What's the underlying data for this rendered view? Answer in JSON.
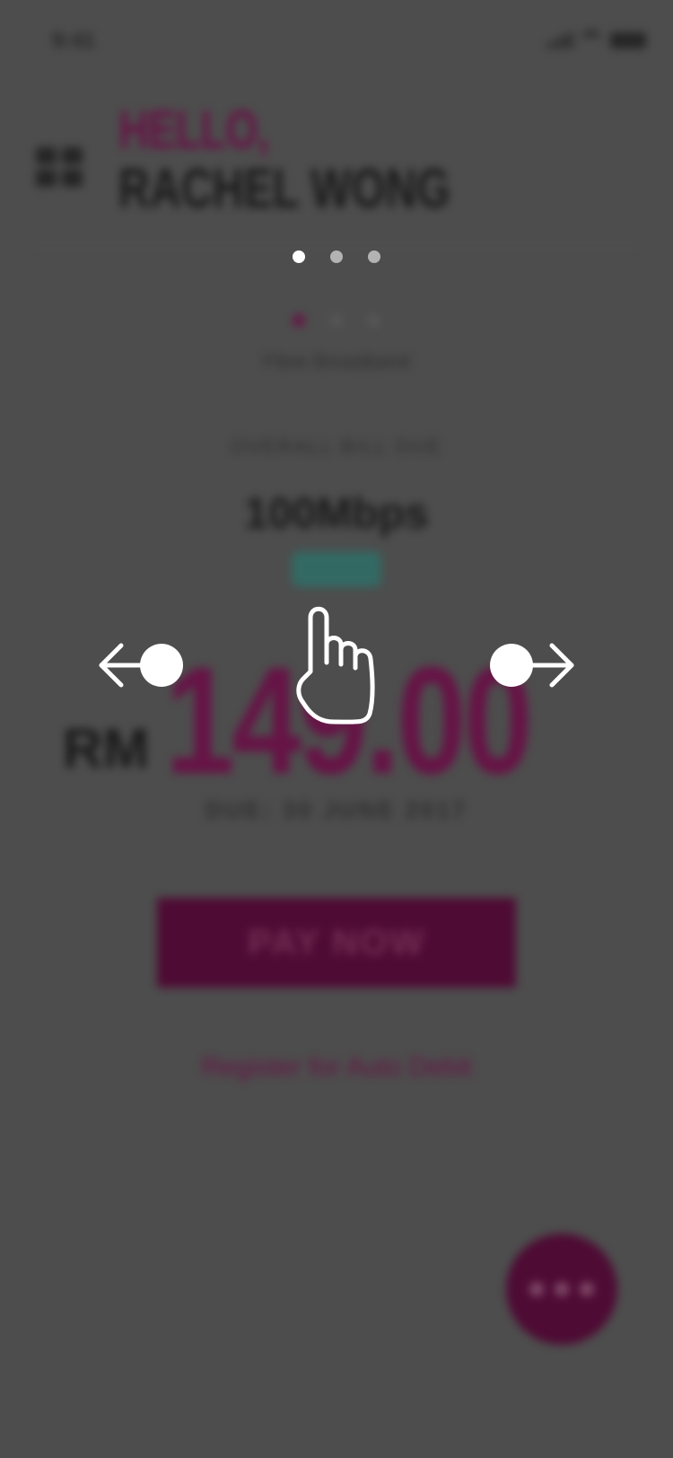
{
  "status_bar": {
    "time": "9:41"
  },
  "header": {
    "greeting": "HELLO,",
    "user_name": "RACHEL WONG"
  },
  "bill_card": {
    "plan_type": "Fibre Broadband",
    "section_label": "OVERALL BILL DUE",
    "speed": "100Mbps",
    "status_badge": "ACTIVE",
    "currency": "RM",
    "amount": "149.00",
    "due_date": "DUE: 30 JUNE 2017",
    "pay_button_label": "PAY NOW",
    "auto_debit_link": "Register for Auto Debit"
  },
  "overlay": {
    "pager_pages": 3,
    "pager_active_index": 0,
    "gesture": "swipe-left-right",
    "icon_names": [
      "arrow-left-icon",
      "arrow-right-icon",
      "hand-pointer-icon"
    ]
  },
  "colors": {
    "brand": "#6b0a45",
    "button": "#4f0030",
    "overlay_dim": "#4d4d4d",
    "badge": "#2f6f68"
  }
}
